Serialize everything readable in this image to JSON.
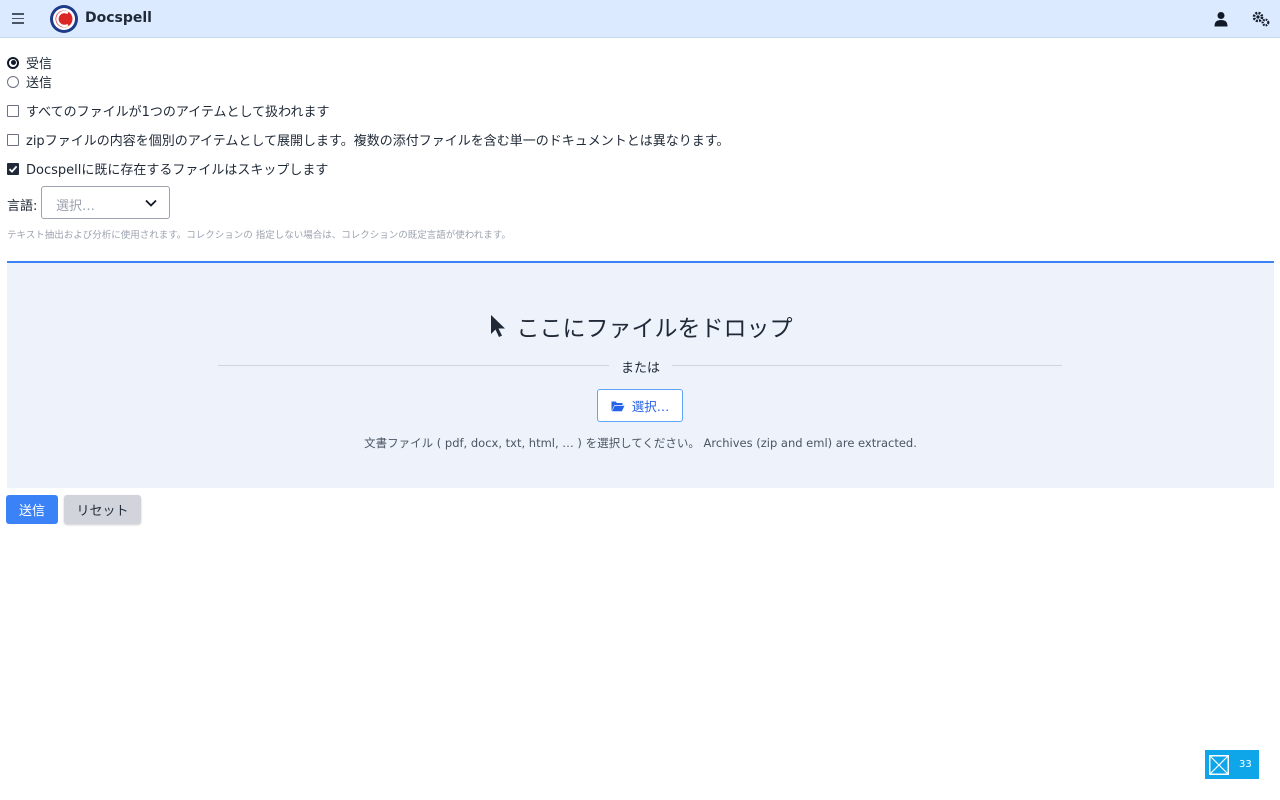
{
  "app": {
    "title": "Docspell"
  },
  "direction": {
    "options": [
      {
        "label": "受信",
        "checked": true
      },
      {
        "label": "送信",
        "checked": false
      }
    ]
  },
  "options": {
    "single_item": {
      "label": "すべてのファイルが1つのアイテムとして扱われます",
      "checked": false
    },
    "flatten_zip": {
      "label": "zipファイルの内容を個別のアイテムとして展開します。複数の添付ファイルを含む単一のドキュメントとは異なります。",
      "checked": false
    },
    "skip_duplicates": {
      "label": "Docspellに既に存在するファイルはスキップします",
      "checked": true
    }
  },
  "language": {
    "label": "言語:",
    "placeholder": "選択…",
    "hint": "テキスト抽出および分析に使用されます。コレクションの 指定しない場合は、コレクションの既定言語が使われます。"
  },
  "dropzone": {
    "title": "ここにファイルをドロップ",
    "or_text": "または",
    "select_label": "選択…",
    "description": "文書ファイル ( pdf, docx, txt, html, … ) を選択してください。 Archives (zip and eml) are extracted."
  },
  "actions": {
    "submit_label": "送信",
    "reset_label": "リセット"
  },
  "badge": {
    "count": "33"
  },
  "colors": {
    "topbar": "#dbeafe",
    "accent": "#3b82f6",
    "dropzone_bg": "#eef2fb",
    "badge": "#0ea5e9"
  },
  "icons": {
    "menu": "hamburger-menu-icon",
    "logo": "docspell-logo",
    "user": "user-icon",
    "settings": "cogs-icon",
    "pointer": "mouse-pointer-icon",
    "folder": "folder-open-icon",
    "chevron": "chevron-down-icon"
  }
}
